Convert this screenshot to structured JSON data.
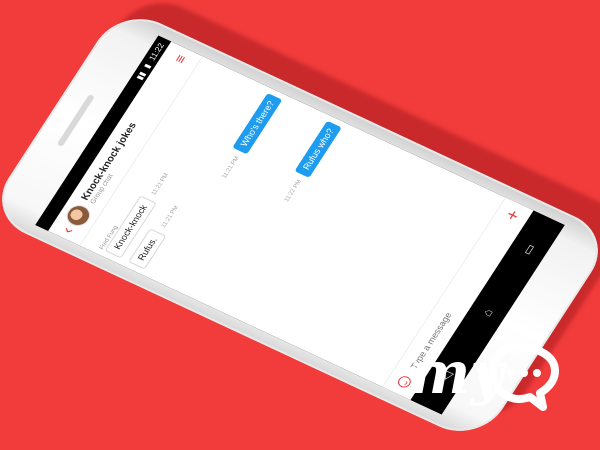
{
  "status_bar": {
    "time": "11:22"
  },
  "header": {
    "back_icon": "back-arrow-icon",
    "title": "Knock-knock jokes",
    "subtitle": "Group chat",
    "menu_icon": "hamburger-menu-icon"
  },
  "messages": [
    {
      "direction": "in",
      "sender": "Fred Fung",
      "text": "Knock-knock",
      "time": "11:21 PM"
    },
    {
      "direction": "out",
      "text": "Who's there?",
      "time": "11:21 PM"
    },
    {
      "direction": "in",
      "text": "Rufus.",
      "time": "11:21 PM"
    },
    {
      "direction": "out",
      "text": "Rufus who?",
      "time": "11:22 PM"
    }
  ],
  "composer": {
    "placeholder": "Type a message",
    "emoji_icon": "smiley-icon",
    "add_icon": "plus-icon"
  },
  "navbar": {
    "back": "nav-back-icon",
    "home": "nav-home-icon",
    "recents": "nav-recents-icon"
  },
  "brand": {
    "logo_text": "my",
    "bubble_dots": "...",
    "accent": "#e8383d",
    "background": "#f23b3b",
    "outgoing_bubble": "#1e9cf0"
  }
}
